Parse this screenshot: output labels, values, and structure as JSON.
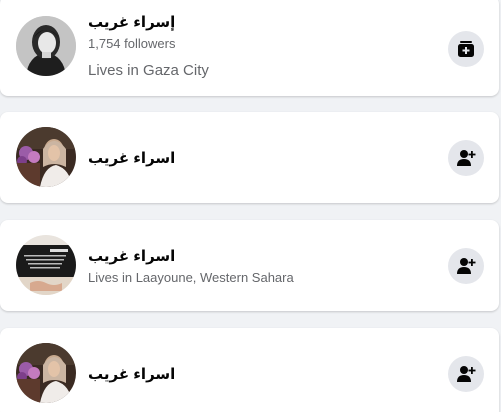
{
  "results": [
    {
      "name": "إسراء غريب",
      "followers": "1,754 followers",
      "lives": "Lives in Gaza City",
      "action_icon": "add-page-icon",
      "avatar": "profile-photo-black-white"
    },
    {
      "name": "اسراء غريب",
      "followers": "",
      "lives": "",
      "action_icon": "add-friend-icon",
      "avatar": "profile-photo-flowers"
    },
    {
      "name": "اسراء غريب",
      "followers": "",
      "lives": "Lives in Laayoune, Western Sahara",
      "action_icon": "add-friend-icon",
      "avatar": "profile-photo-sign"
    },
    {
      "name": "اسراء غريب",
      "followers": "",
      "lives": "",
      "action_icon": "add-friend-icon",
      "avatar": "profile-photo-flowers"
    }
  ],
  "colors": {
    "page_background": "#f0f2f5",
    "card_background": "#ffffff",
    "button_background": "#e4e6eb",
    "name_text": "#050505",
    "meta_text": "#65676b"
  }
}
